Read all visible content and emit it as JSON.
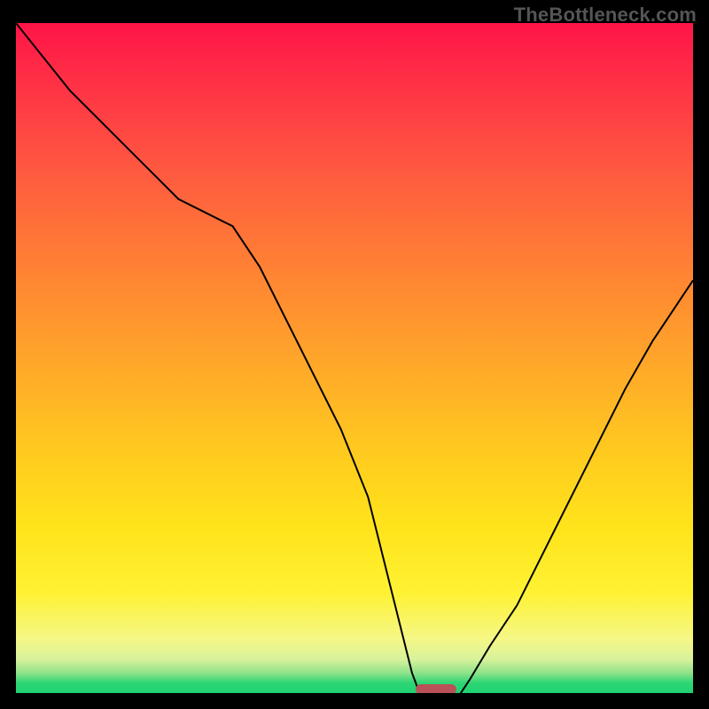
{
  "watermark": "TheBottleneck.com",
  "colors": {
    "background": "#000000",
    "curve": "#000000",
    "marker": "#b85158"
  },
  "chart_data": {
    "type": "line",
    "title": "",
    "xlabel": "",
    "ylabel": "",
    "xlim": [
      0,
      100
    ],
    "ylim": [
      0,
      100
    ],
    "series": [
      {
        "name": "bottleneck-curve",
        "x": [
          0,
          4,
          8,
          12,
          16,
          20,
          24,
          28,
          32,
          36,
          40,
          44,
          48,
          52,
          55,
          57,
          58.5,
          60,
          62,
          65,
          67,
          70,
          74,
          78,
          82,
          86,
          90,
          94,
          98,
          100
        ],
        "y": [
          100,
          95,
          90,
          86,
          82,
          78,
          74,
          72,
          70,
          64,
          56,
          48,
          40,
          30,
          18,
          10,
          4,
          0,
          0,
          0,
          3,
          8,
          14,
          22,
          30,
          38,
          46,
          53,
          59,
          62
        ]
      }
    ],
    "marker": {
      "x_center": 62,
      "y_center": 0.5,
      "width": 6,
      "height": 1.6
    },
    "gradient_stops": [
      {
        "pos": 0,
        "color": "#ff1448"
      },
      {
        "pos": 50,
        "color": "#ffa52a"
      },
      {
        "pos": 85,
        "color": "#fff233"
      },
      {
        "pos": 100,
        "color": "#1fd173"
      }
    ]
  }
}
